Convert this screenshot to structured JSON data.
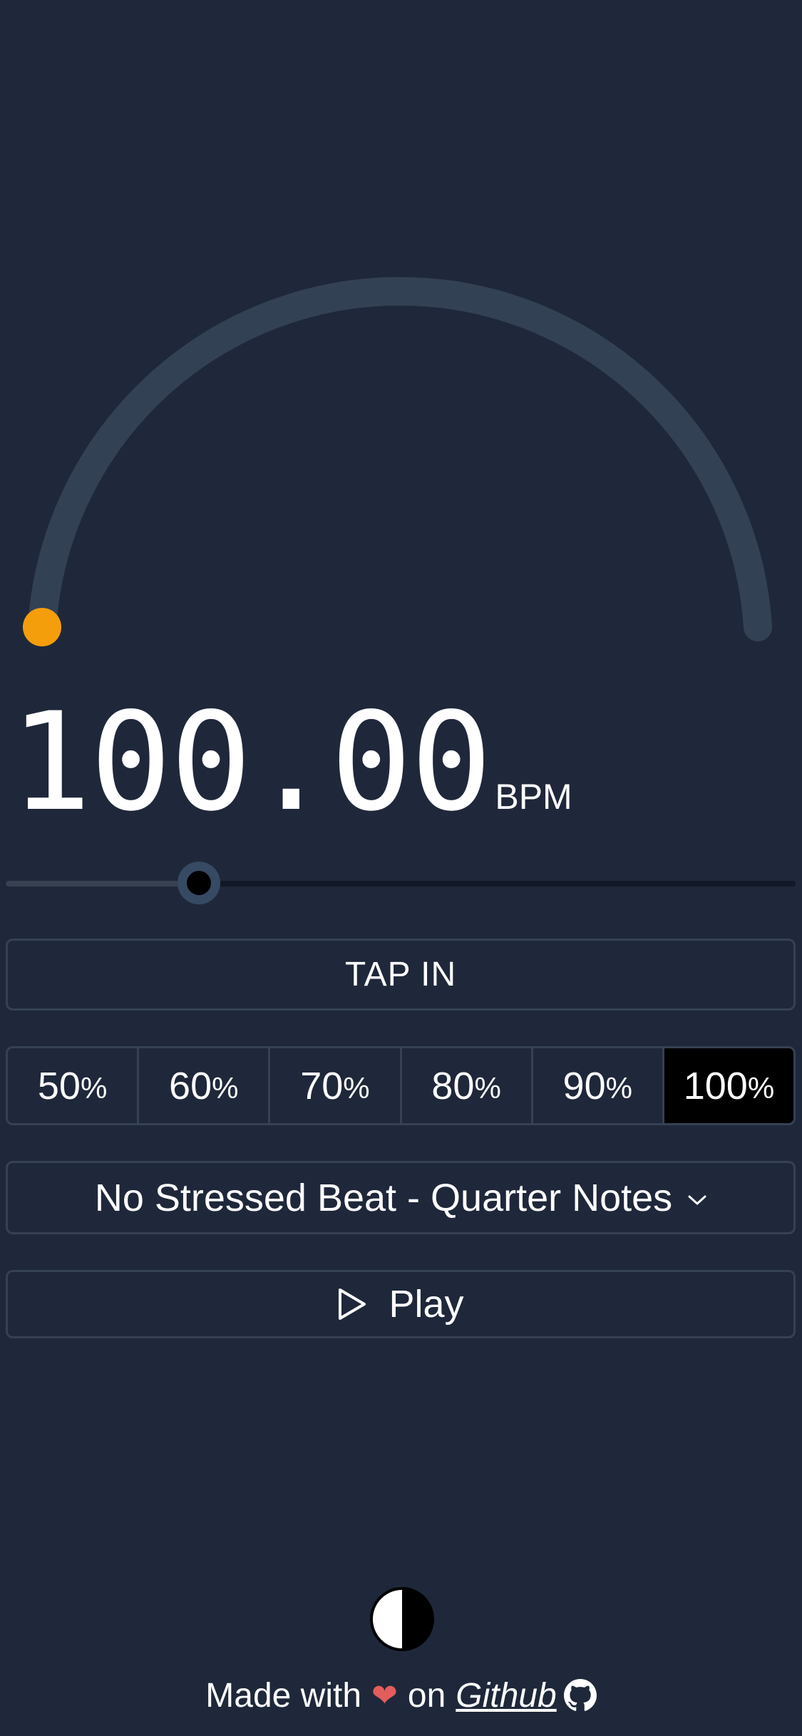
{
  "tempo": {
    "bpm_display": "100.00",
    "unit": "BPM",
    "bpm_value": 100.0,
    "dial_fraction": 0.0,
    "slider_fraction": 0.245
  },
  "colors": {
    "background": "#1f283a",
    "dial_track": "#334155",
    "dial_handle": "#f59e0b",
    "border": "#354154",
    "active_button": "#000000",
    "heart": "#e35d5d"
  },
  "controls": {
    "tap_in_label": "TAP IN",
    "percent_options": [
      {
        "value": "50",
        "sign": "%",
        "active": false
      },
      {
        "value": "60",
        "sign": "%",
        "active": false
      },
      {
        "value": "70",
        "sign": "%",
        "active": false
      },
      {
        "value": "80",
        "sign": "%",
        "active": false
      },
      {
        "value": "90",
        "sign": "%",
        "active": false
      },
      {
        "value": "100",
        "sign": "%",
        "active": true
      }
    ],
    "beat_pattern": "No Stressed Beat - Quarter Notes",
    "play_label": "Play"
  },
  "icons": {
    "play": "play-icon",
    "chevron": "chevron-down-icon",
    "theme": "half-circle-theme-icon",
    "heart": "heart-icon",
    "github": "github-icon"
  },
  "footer": {
    "made_with": "Made with",
    "heart": "❤",
    "on": "on",
    "link_text": "Github"
  }
}
